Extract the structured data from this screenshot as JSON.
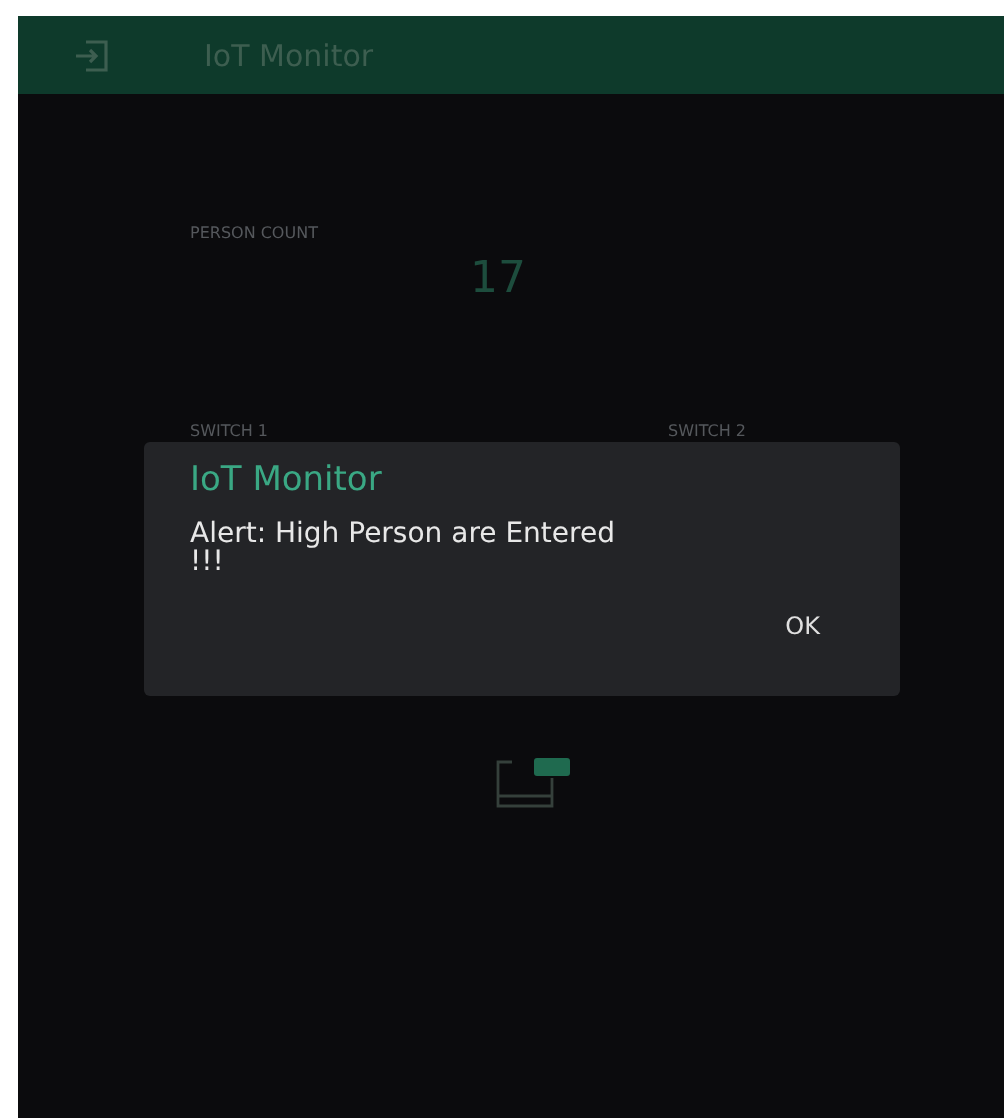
{
  "app_bar": {
    "title": "IoT Monitor"
  },
  "widgets": {
    "person_count": {
      "label": "PERSON COUNT",
      "value": "17"
    },
    "switches": [
      {
        "label": "SWITCH 1"
      },
      {
        "label": "SWITCH 2"
      }
    ]
  },
  "dialog": {
    "title": "IoT Monitor",
    "message": "Alert: High Person are Entered !!!",
    "buttons": [
      "OK"
    ]
  }
}
